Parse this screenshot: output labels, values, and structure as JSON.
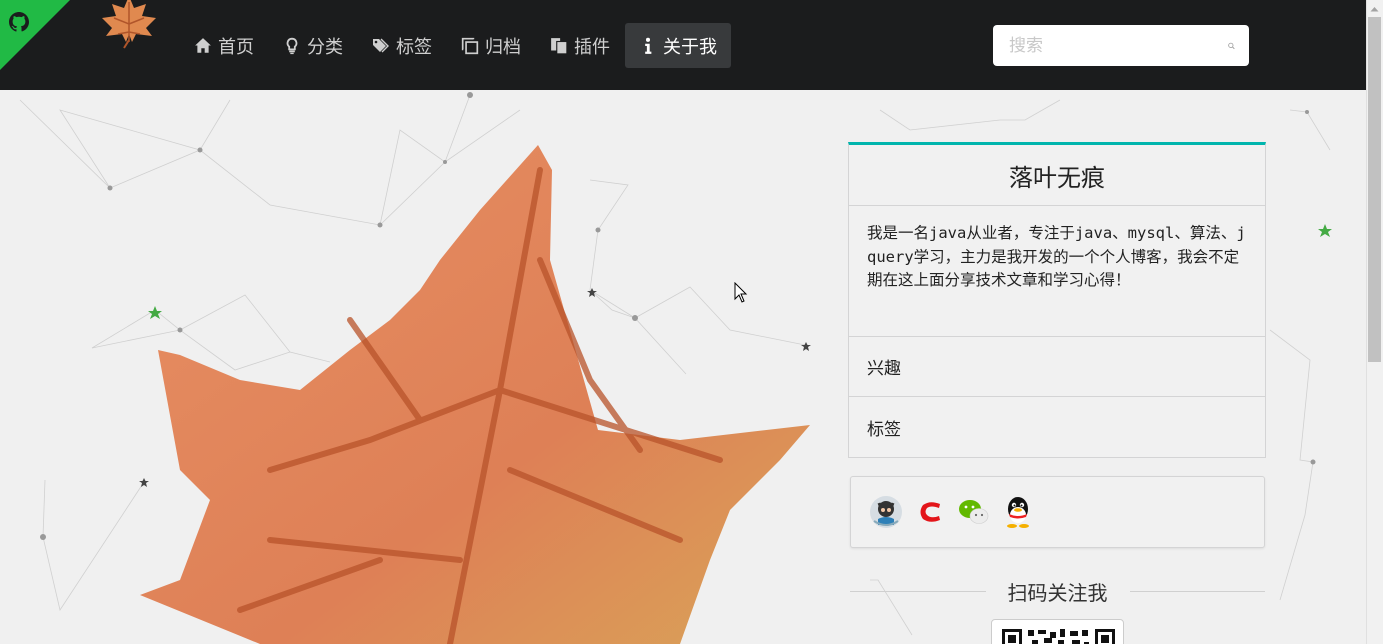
{
  "nav": {
    "items": [
      {
        "label": "首页",
        "icon": "home-icon"
      },
      {
        "label": "分类",
        "icon": "lightbulb-icon"
      },
      {
        "label": "标签",
        "icon": "tags-icon"
      },
      {
        "label": "归档",
        "icon": "clone-icon"
      },
      {
        "label": "插件",
        "icon": "copy-icon"
      },
      {
        "label": "关于我",
        "icon": "info-icon",
        "active": true
      }
    ],
    "search_placeholder": "搜索"
  },
  "profile": {
    "name": "落叶无痕",
    "description": "我是一名java从业者，专注于java、mysql、算法、jquery学习，主力是我开发的一个个人博客，我会不定期在这上面分享技术文章和学习心得！",
    "rows": [
      "兴趣",
      "标签"
    ]
  },
  "social": [
    "github-icon",
    "csdn-icon",
    "wechat-icon",
    "qq-icon"
  ],
  "qr": {
    "heading": "扫码关注我"
  },
  "colors": {
    "nav_bg": "#1b1c1d",
    "accent": "#00b5ad",
    "corner": "#21ba45",
    "leaf": "#d9764a"
  }
}
